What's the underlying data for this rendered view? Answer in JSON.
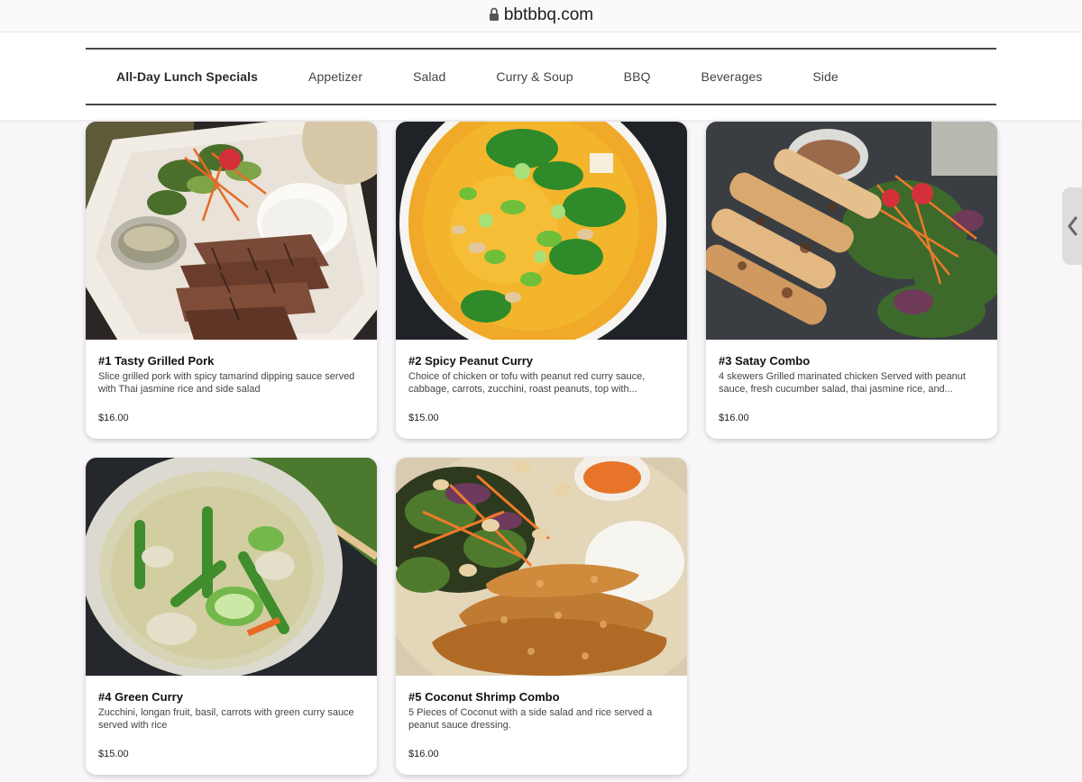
{
  "browser": {
    "url": "bbtbbq.com"
  },
  "nav": {
    "tabs": [
      {
        "label": "All-Day Lunch Specials"
      },
      {
        "label": "Appetizer"
      },
      {
        "label": "Salad"
      },
      {
        "label": "Curry & Soup"
      },
      {
        "label": "BBQ"
      },
      {
        "label": "Beverages"
      },
      {
        "label": "Side"
      }
    ]
  },
  "menu_items": [
    {
      "title": "#1 Tasty Grilled Pork",
      "description": "Slice grilled pork with spicy tamarind dipping sauce served with Thai jasmine rice and side salad",
      "price": "$16.00"
    },
    {
      "title": "#2 Spicy Peanut Curry",
      "description": "Choice of chicken or tofu with peanut red curry sauce, cabbage, carrots, zucchini, roast peanuts, top with...",
      "price": "$15.00"
    },
    {
      "title": "#3 Satay Combo",
      "description": "4 skewers Grilled marinated chicken Served with peanut sauce, fresh cucumber salad, thai jasmine rice, and...",
      "price": "$16.00"
    },
    {
      "title": "#4 Green Curry",
      "description": "Zucchini, longan fruit, basil, carrots with green curry sauce served with rice",
      "price": "$15.00"
    },
    {
      "title": "#5 Coconut Shrimp Combo",
      "description": "5 Pieces of Coconut with a side salad and rice served a peanut sauce dressing.",
      "price": "$16.00"
    }
  ]
}
